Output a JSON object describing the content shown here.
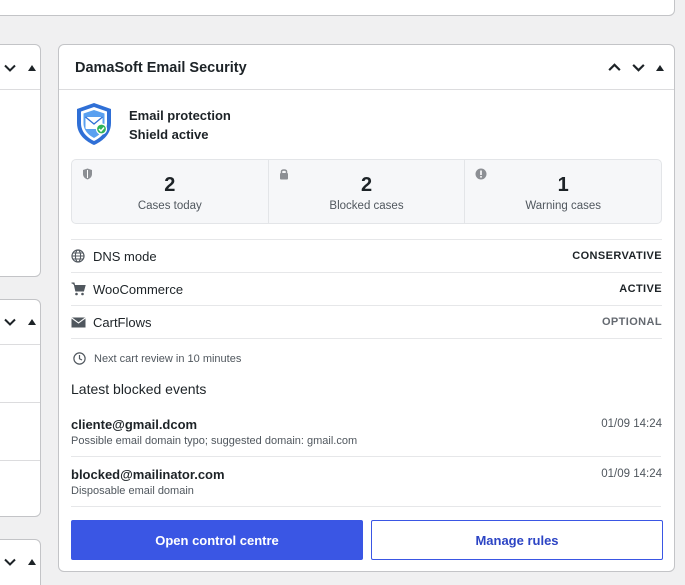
{
  "widget": {
    "title": "DamaSoft Email Security",
    "protection_title": "Email protection",
    "protection_status": "Shield active",
    "stats": [
      {
        "icon": "shield-icon",
        "value": "2",
        "label": "Cases today"
      },
      {
        "icon": "lock-icon",
        "value": "2",
        "label": "Blocked cases"
      },
      {
        "icon": "warning-icon",
        "value": "1",
        "label": "Warning cases"
      }
    ],
    "settings": [
      {
        "icon": "globe-icon",
        "name": "DNS mode",
        "value": "CONSERVATIVE"
      },
      {
        "icon": "cart-icon",
        "name": "WooCommerce",
        "value": "ACTIVE"
      },
      {
        "icon": "envelope-icon",
        "name": "CartFlows",
        "value": "OPTIONAL"
      }
    ],
    "next_review": "Next cart review in 10 minutes",
    "latest_heading": "Latest blocked events",
    "events": [
      {
        "email": "cliente@gmail.dcom",
        "description": "Possible email domain typo; suggested domain: gmail.com",
        "time": "01/09 14:24"
      },
      {
        "email": "blocked@mailinator.com",
        "description": "Disposable email domain",
        "time": "01/09 14:24"
      }
    ],
    "buttons": {
      "primary": "Open control centre",
      "secondary": "Manage rules"
    }
  },
  "colors": {
    "accent": "#3a56e4",
    "background": "#f0f0f1",
    "shield_blue": "#2f6fd6",
    "check_green": "#2fb35a"
  }
}
